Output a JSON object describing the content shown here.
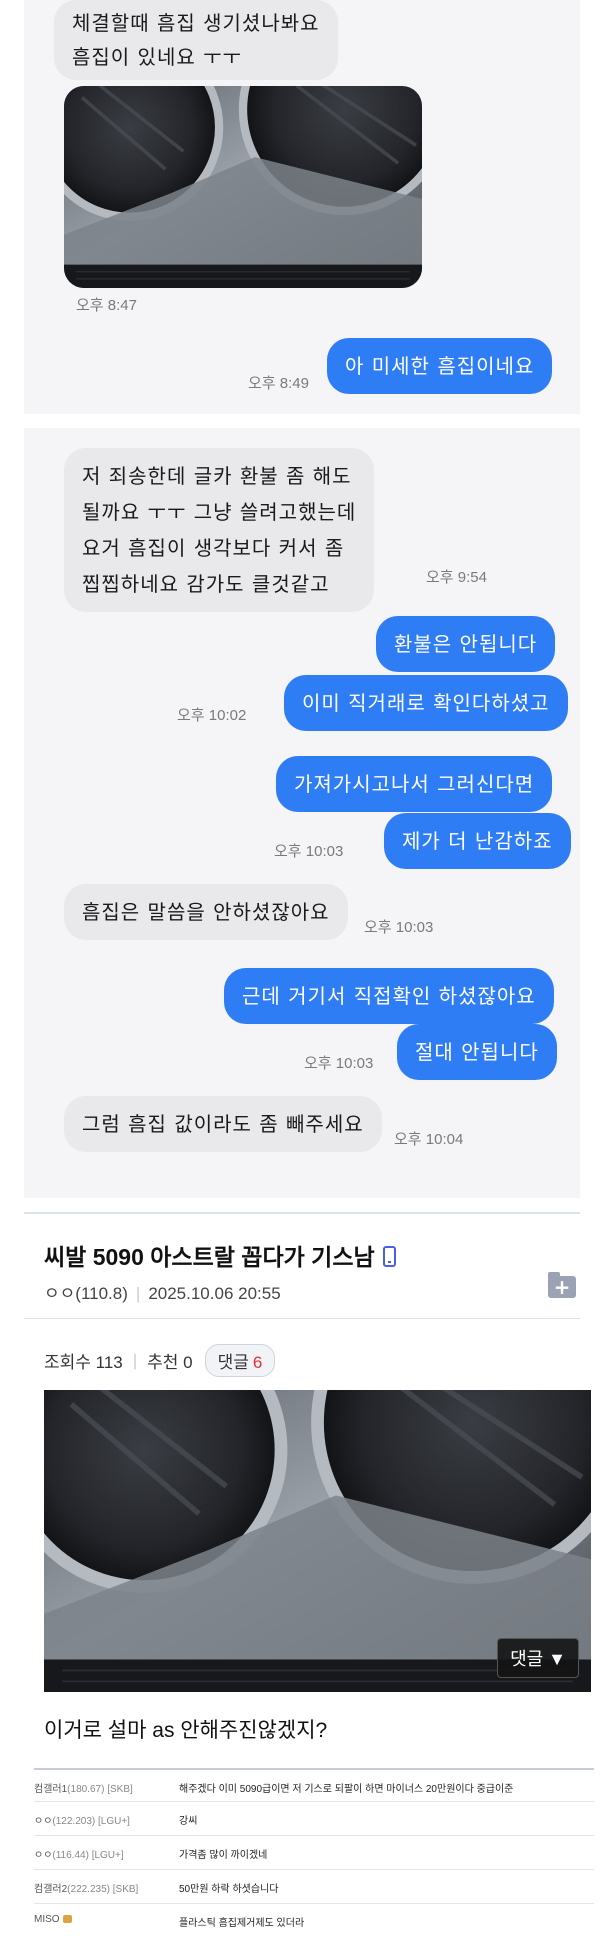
{
  "chat1": {
    "bubble1_lines": [
      "체결할때 흠집 생기셨나봐요",
      "흠집이 있네요 ㅜㅜ"
    ],
    "time1": "오후 8:47",
    "bubble2": "아 미세한 흠집이네요",
    "time2": "오후 8:49"
  },
  "chat2": {
    "msg1_lines": [
      "저 죄송한데 글카 환불 좀 해도",
      "될까요 ㅜㅜ 그냥 쓸려고했는데",
      "요거 흠집이 생각보다 커서 좀",
      "찝찝하네요 감가도 클것같고"
    ],
    "time1": "오후 9:54",
    "msg2": "환불은 안됩니다",
    "msg3": "이미 직거래로 확인다하셨고",
    "time3": "오후 10:02",
    "msg4": "가져가시고나서 그러신다면",
    "msg5": "제가 더 난감하죠",
    "time5": "오후 10:03",
    "msg6": "흠집은 말씀을 안하셨잖아요",
    "time6": "오후 10:03",
    "msg7": "근데 거기서 직접확인 하셨잖아요",
    "msg8": "절대 안됩니다",
    "time8": "오후 10:03",
    "msg9": "그럼 흠집 값이라도 좀 빼주세요",
    "time9": "오후 10:04"
  },
  "post": {
    "title": "씨발 5090 아스트랄 꼽다가 기스남",
    "author": "ㅇㅇ(110.8)",
    "date": "2025.10.06 20:55",
    "views": "조회수 113",
    "recommend": "추천 0",
    "comments_label": "댓글",
    "comments_count": "6",
    "overlay_button": "댓글 ▼",
    "body": "이거로 설마 as 안해주진않겠지?"
  },
  "comments": [
    {
      "nick": "컴갤러1",
      "tag": "(180.67) [SKB]",
      "text": "해주겠다 이미 5090급이면 저 기스로 되팔이 하면 마이너스 20만원이다 중급이준"
    },
    {
      "nick": "ㅇㅇ",
      "tag": "(122.203) [LGU+]",
      "text": "강씨"
    },
    {
      "nick": "ㅇㅇ",
      "tag": "(116.44) [LGU+]",
      "text": "가격좀 많이 까이겠네"
    },
    {
      "nick": "컴갤러2",
      "tag": "(222.235) [SKB]",
      "text": "50만원 하락 하셧습니다"
    },
    {
      "nick": "MISO",
      "tag": "",
      "text": "플라스틱 흠집제거제도 있더라"
    }
  ],
  "colors": {
    "outgoing_bubble": "#2f7df5",
    "incoming_bubble": "#e9e9ec",
    "chat_bg": "#f5f5f7",
    "comment_count": "#e03131"
  },
  "icons": [
    "phone-icon",
    "add-folder-icon",
    "lock-icon"
  ]
}
